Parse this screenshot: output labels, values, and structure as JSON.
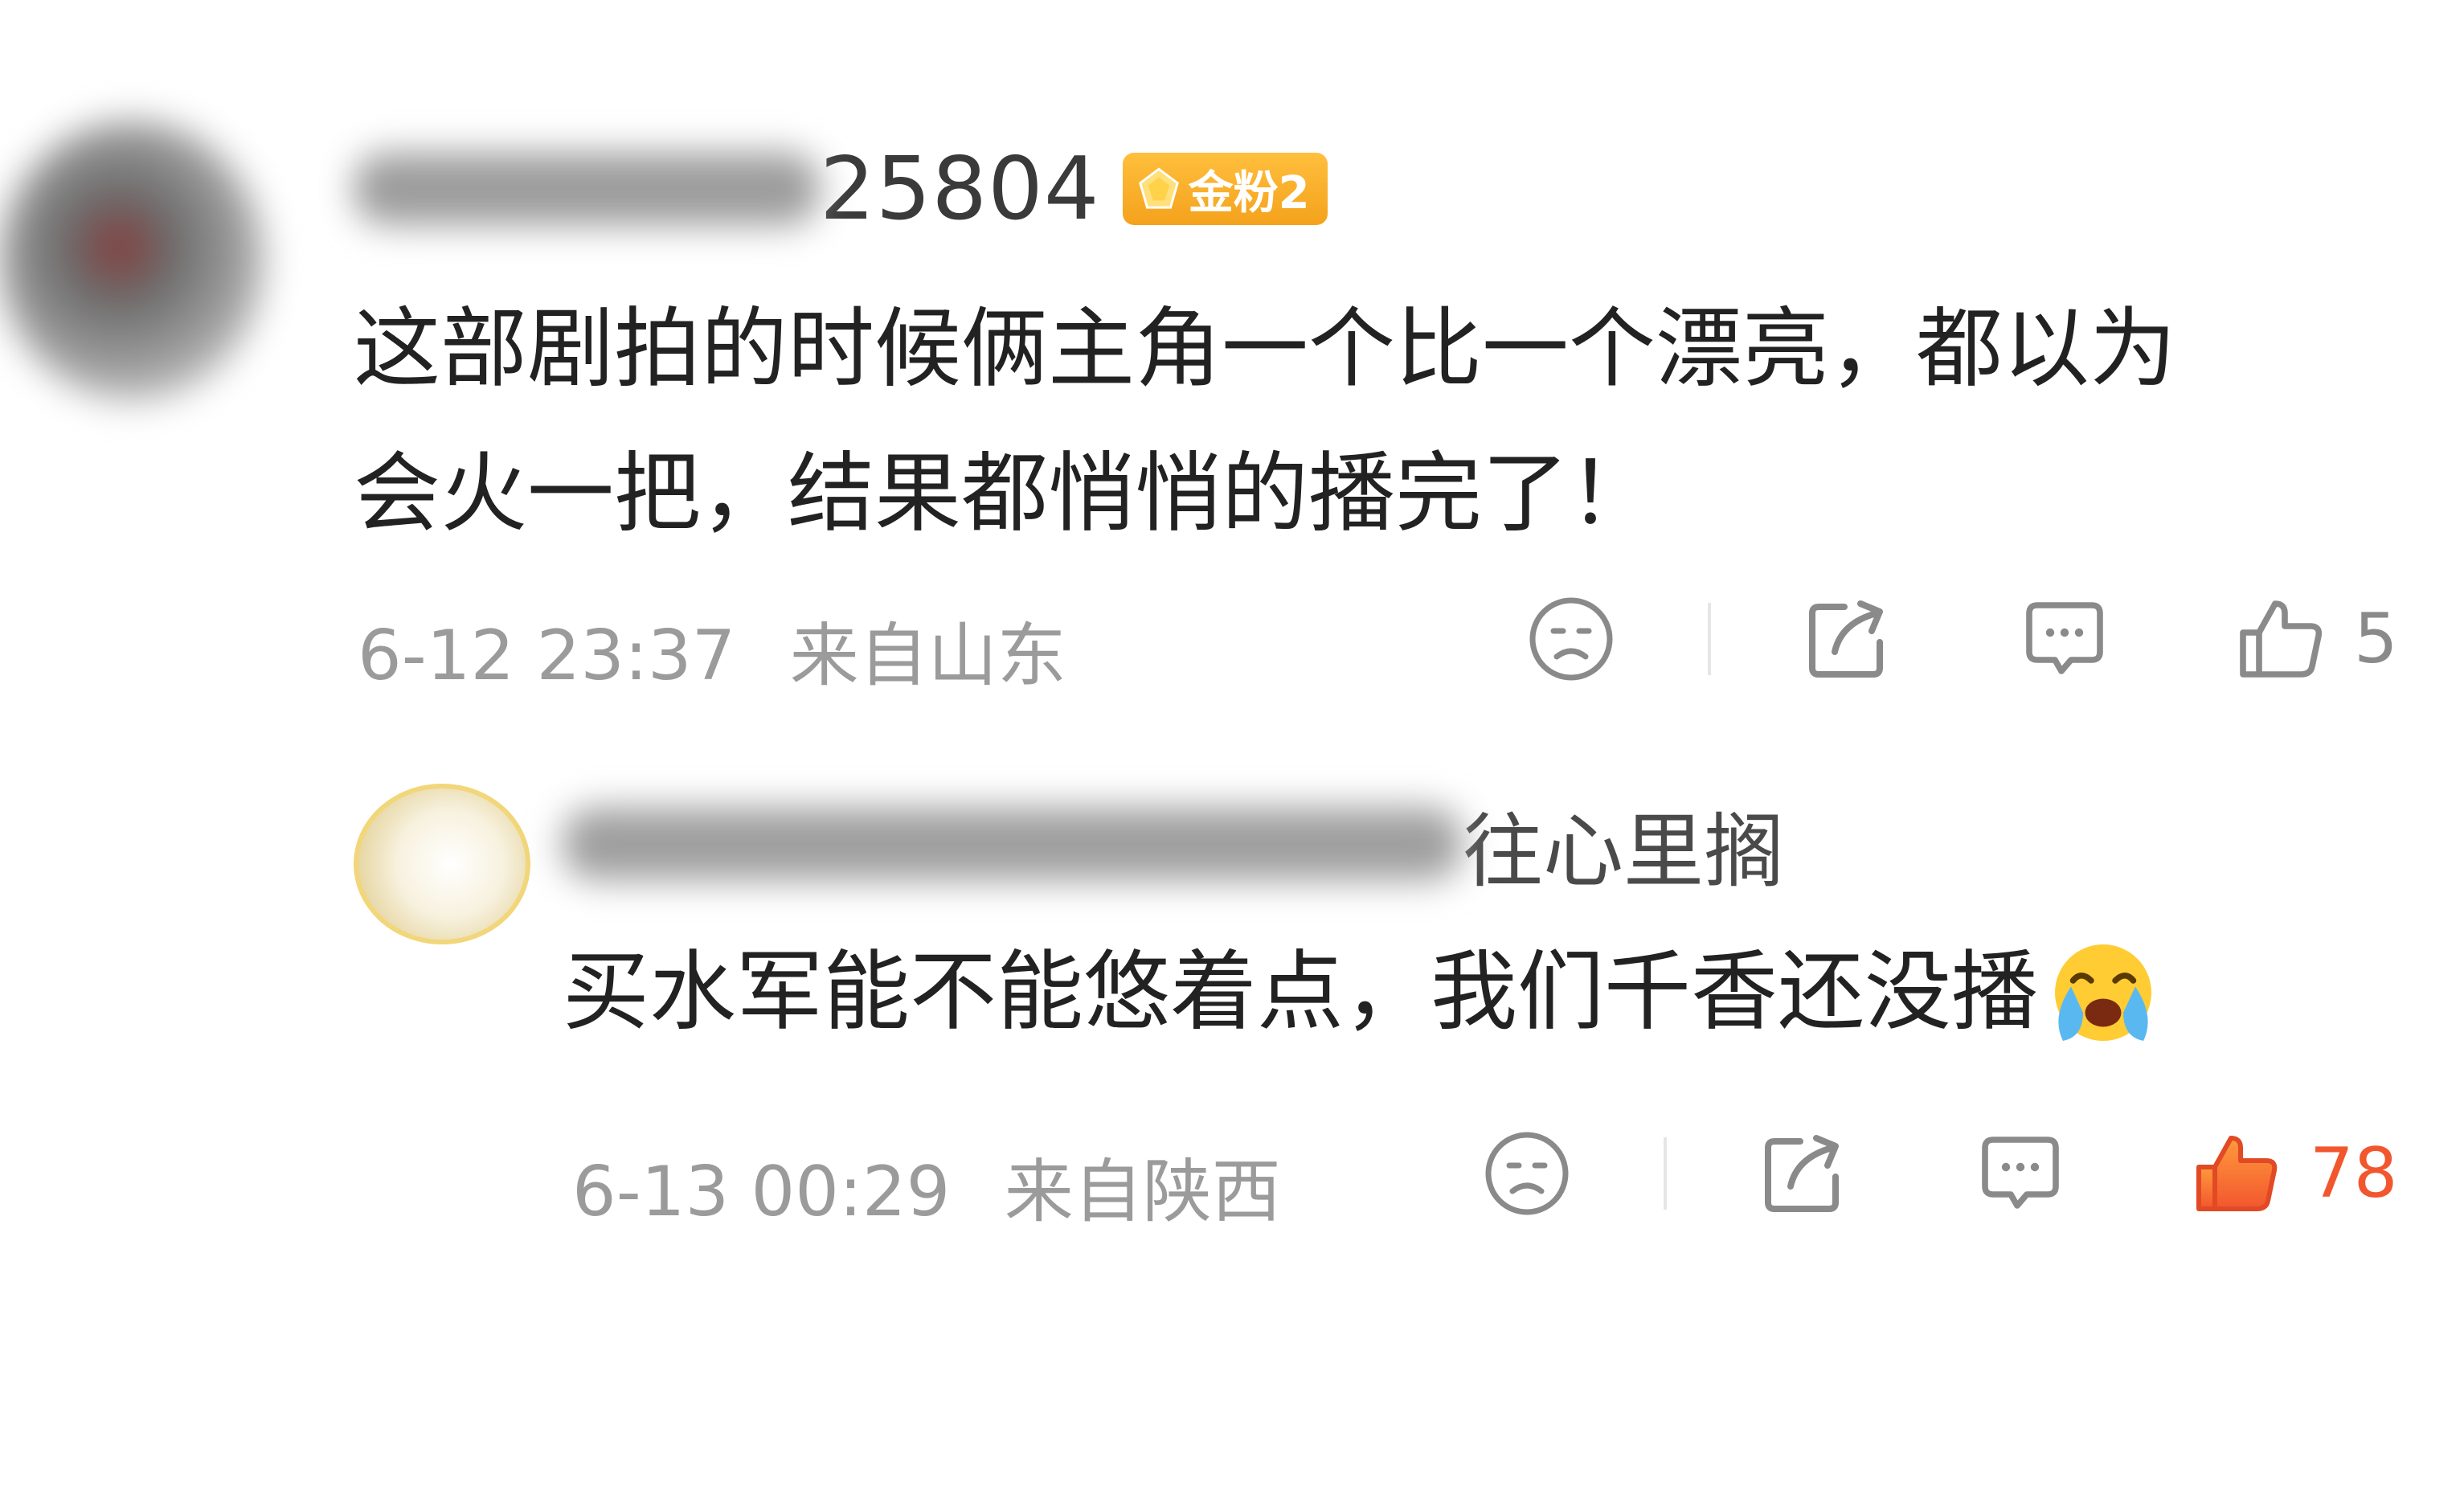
{
  "comment1": {
    "username_visible": "25804",
    "fan_badge": "金粉2",
    "text_line1": "这部剧拍的时候俩主角一个比一个漂亮，都以为",
    "text_line2": "会火一把，结果都悄悄的播完了！",
    "time": "6-12 23:37",
    "location": "来自山东",
    "like_count": "5",
    "liked": false
  },
  "comment2": {
    "username_visible": "往心里搁",
    "text": "买水军能不能悠着点，我们千香还没播",
    "emoji": "crying-face-emoji",
    "time": "6-13 00:29",
    "location": "来自陕西",
    "like_count": "78",
    "liked": true
  },
  "colors": {
    "meta_gray": "#9b9b9b",
    "badge_gold": "#f4a21c",
    "liked_red": "#f2562e"
  }
}
